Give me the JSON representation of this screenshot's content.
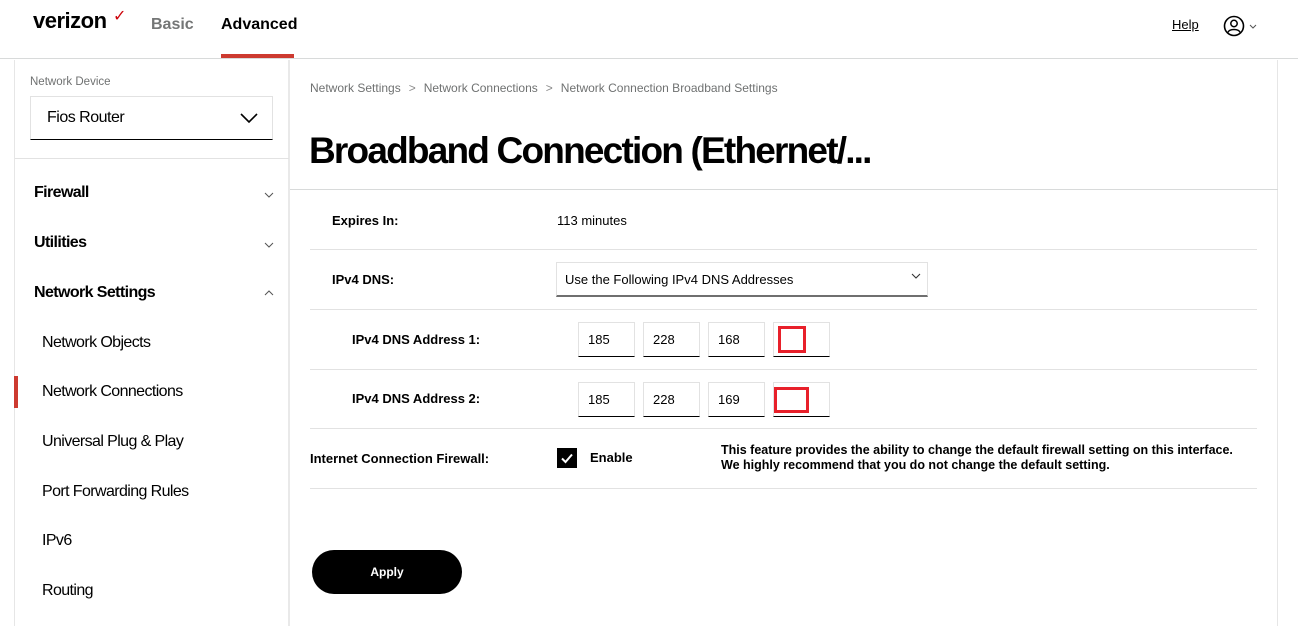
{
  "header": {
    "logo": "verizon",
    "logo_mark": "✓",
    "tabs": [
      {
        "label": "Basic",
        "active": false
      },
      {
        "label": "Advanced",
        "active": true
      }
    ],
    "help_label": "Help",
    "account_icon": "user-circle-icon",
    "accent_color": "#cd3a30"
  },
  "sidebar": {
    "device_label": "Network Device",
    "device_value": "Fios Router",
    "groups": [
      {
        "label": "Firewall",
        "expanded": false
      },
      {
        "label": "Utilities",
        "expanded": false
      },
      {
        "label": "Network Settings",
        "expanded": true
      }
    ],
    "items": [
      {
        "label": "Network Objects",
        "active": false
      },
      {
        "label": "Network Connections",
        "active": true
      },
      {
        "label": "Universal Plug & Play",
        "active": false
      },
      {
        "label": "Port Forwarding Rules",
        "active": false
      },
      {
        "label": "IPv6",
        "active": false
      },
      {
        "label": "Routing",
        "active": false
      }
    ]
  },
  "main": {
    "breadcrumb": [
      "Network Settings",
      "Network Connections",
      "Network Connection Broadband Settings"
    ],
    "title": "Broadband Connection (Ethernet/...",
    "expires": {
      "label": "Expires In:",
      "value": "113 minutes"
    },
    "ipv4_dns": {
      "label": "IPv4 DNS:",
      "value": "Use the Following IPv4 DNS Addresses"
    },
    "dns1": {
      "label": "IPv4 DNS Address 1:",
      "octets": [
        "185",
        "228",
        "168",
        ""
      ]
    },
    "dns2": {
      "label": "IPv4 DNS Address 2:",
      "octets": [
        "185",
        "228",
        "169",
        ""
      ]
    },
    "firewall": {
      "label": "Internet Connection Firewall:",
      "checked": true,
      "checkbox_label": "Enable",
      "note": "This feature provides the ability to change the default firewall setting on this interface. We highly recommend that you do not change the default setting."
    },
    "apply_label": "Apply",
    "highlight_color": "#e8202a"
  }
}
